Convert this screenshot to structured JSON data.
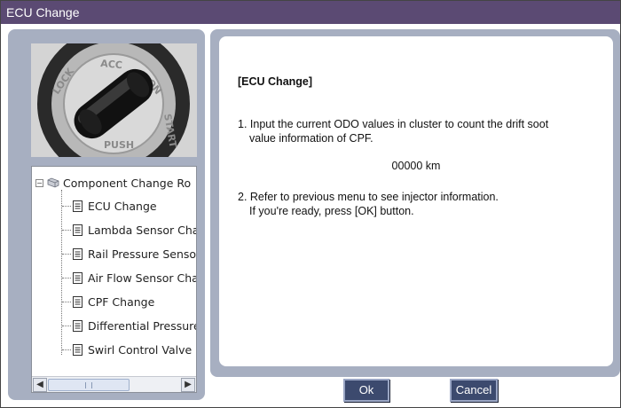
{
  "window": {
    "title": "ECU Change"
  },
  "tree": {
    "root_label": "Component Change Ro",
    "items": [
      {
        "label": "ECU Change"
      },
      {
        "label": "Lambda Sensor Cha"
      },
      {
        "label": "Rail Pressure Sensoi"
      },
      {
        "label": "Air Flow Sensor Cha"
      },
      {
        "label": "CPF Change"
      },
      {
        "label": "Differential Pressure"
      },
      {
        "label": "Swirl Control Valve ("
      }
    ],
    "icons": {
      "root": "folder-icon",
      "item": "document-icon"
    }
  },
  "content": {
    "title": "[ECU Change]",
    "step1_line1": "1. Input the current ODO values in cluster to count the drift soot",
    "step1_line2": "value information of CPF.",
    "odo_value": "00000 km",
    "step2_line1": "2. Refer to previous menu to see injector information.",
    "step2_line2": "If you're ready, press [OK] button."
  },
  "buttons": {
    "ok": "Ok",
    "cancel": "Cancel"
  },
  "colors": {
    "titlebar": "#5b4a73",
    "panel": "#a7afc1",
    "button": "#3c4a6e"
  }
}
